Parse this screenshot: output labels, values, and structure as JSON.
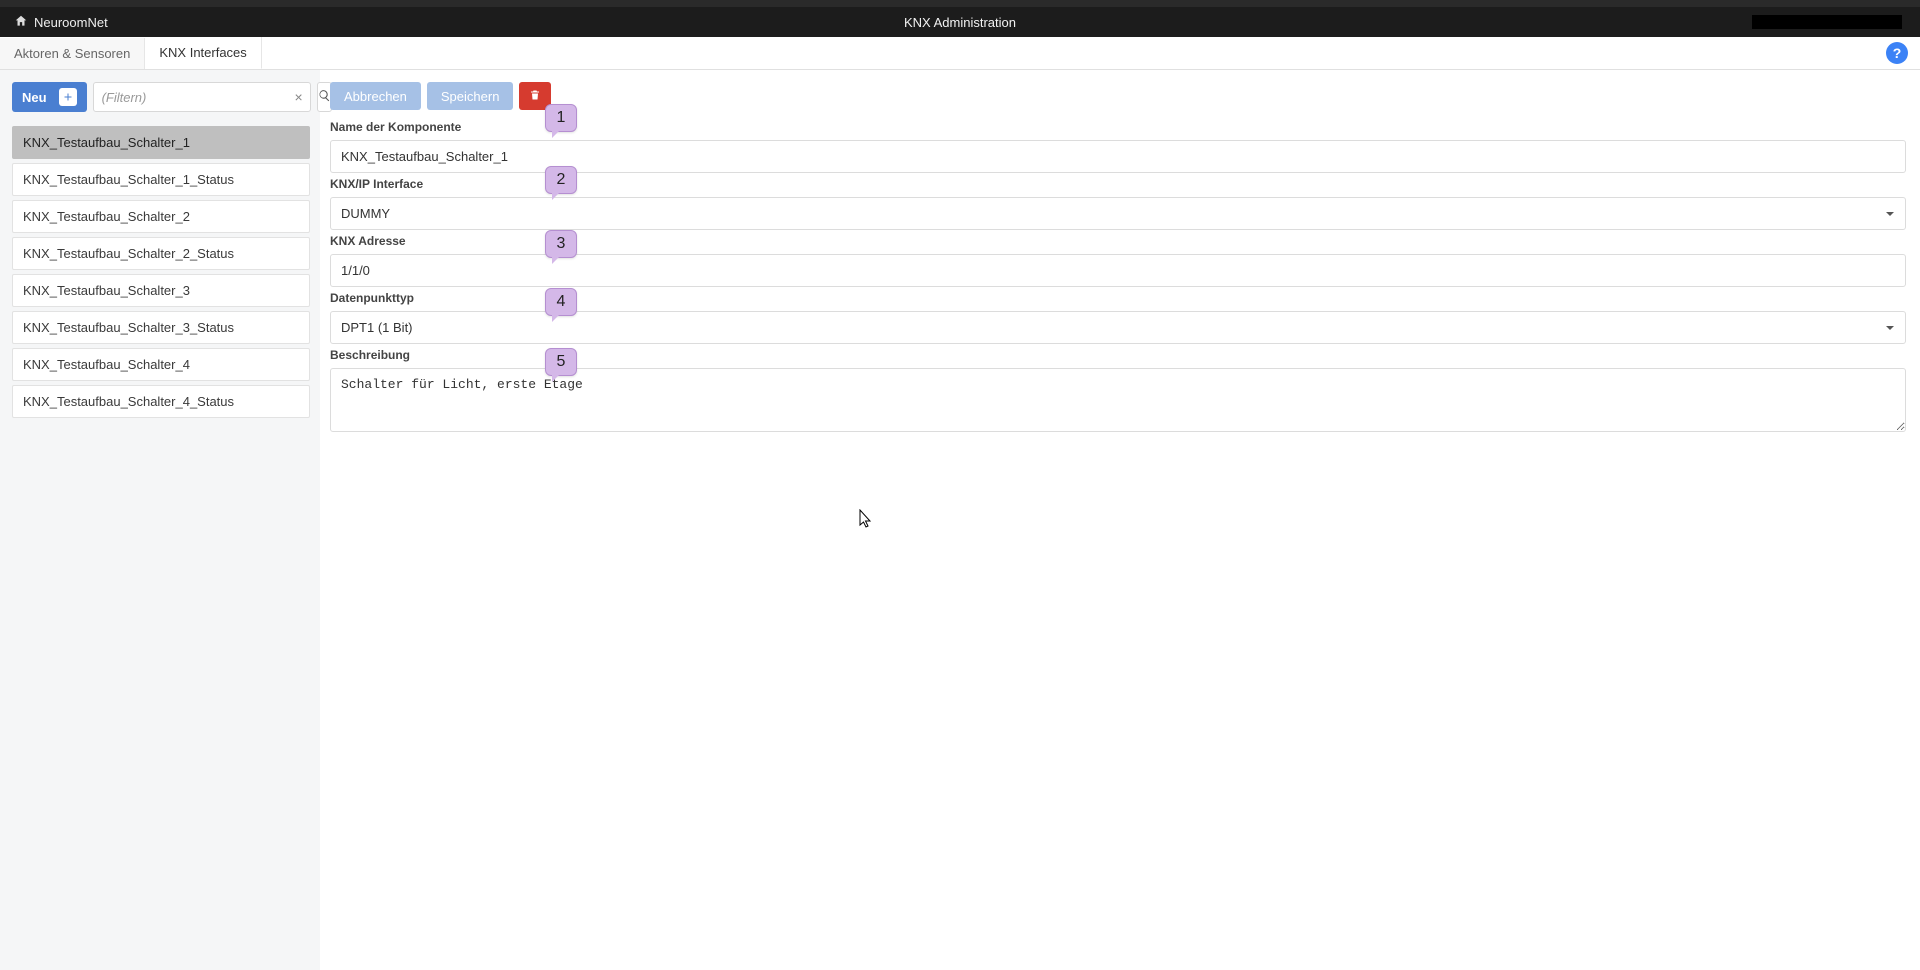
{
  "header": {
    "brand": "NeuroomNet",
    "title": "KNX Administration"
  },
  "tabs": [
    {
      "label": "Aktoren & Sensoren",
      "active": false
    },
    {
      "label": "KNX Interfaces",
      "active": true
    }
  ],
  "sidebar": {
    "new_label": "Neu",
    "filter_placeholder": "(Filtern)",
    "items": [
      {
        "name": "KNX_Testaufbau_Schalter_1",
        "selected": true
      },
      {
        "name": "KNX_Testaufbau_Schalter_1_Status",
        "selected": false
      },
      {
        "name": "KNX_Testaufbau_Schalter_2",
        "selected": false
      },
      {
        "name": "KNX_Testaufbau_Schalter_2_Status",
        "selected": false
      },
      {
        "name": "KNX_Testaufbau_Schalter_3",
        "selected": false
      },
      {
        "name": "KNX_Testaufbau_Schalter_3_Status",
        "selected": false
      },
      {
        "name": "KNX_Testaufbau_Schalter_4",
        "selected": false
      },
      {
        "name": "KNX_Testaufbau_Schalter_4_Status",
        "selected": false
      }
    ]
  },
  "form": {
    "actions": {
      "cancel": "Abbrechen",
      "save": "Speichern"
    },
    "fields": {
      "name": {
        "label": "Name der Komponente",
        "value": "KNX_Testaufbau_Schalter_1"
      },
      "interface": {
        "label": "KNX/IP Interface",
        "value": "DUMMY"
      },
      "address": {
        "label": "KNX Adresse",
        "value": "1/1/0"
      },
      "dpt": {
        "label": "Datenpunkttyp",
        "value": "DPT1 (1 Bit)"
      },
      "description": {
        "label": "Beschreibung",
        "value": "Schalter für Licht, erste Etage"
      }
    }
  },
  "callouts": [
    "1",
    "2",
    "3",
    "4",
    "5"
  ]
}
